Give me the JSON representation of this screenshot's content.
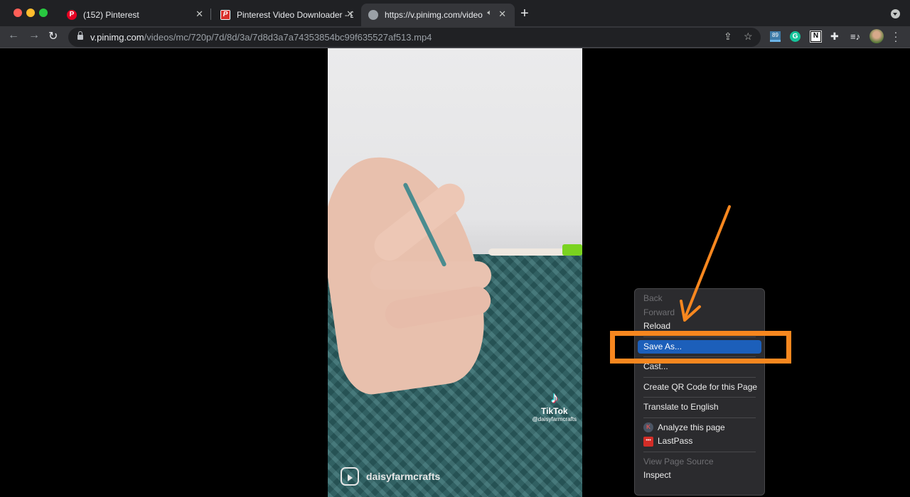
{
  "browser": {
    "tabs": [
      {
        "title": "(152) Pinterest",
        "favicon": "pinterest-icon",
        "active": false
      },
      {
        "title": "Pinterest Video Downloader - D",
        "favicon": "pinterest-video-downloader-icon",
        "active": false
      },
      {
        "title": "https://v.pinimg.com/video",
        "favicon": "globe-icon",
        "active": true,
        "audio": "speaker-icon"
      }
    ],
    "new_tab_glyph": "+",
    "close_glyph": "✕",
    "address": {
      "host": "v.pinimg.com",
      "path": "/videos/mc/720p/7d/8d/3a/7d8d3a7a74353854bc99f635527af513.mp4"
    },
    "toolbar_icons": [
      "share-icon",
      "bookmark-star-icon"
    ],
    "extensions": [
      {
        "name": "ext-89-icon",
        "label": "89"
      },
      {
        "name": "grammarly-icon",
        "label": "G"
      },
      {
        "name": "notion-icon",
        "label": "N"
      },
      {
        "name": "extensions-puzzle-icon",
        "label": ""
      },
      {
        "name": "media-control-icon",
        "label": ""
      }
    ]
  },
  "video": {
    "tiktok_brand": "TikTok",
    "tiktok_handle": "@daisyfarmcrafts",
    "reels_username": "daisyfarmcrafts"
  },
  "context_menu": {
    "groups": [
      [
        {
          "label": "Back",
          "disabled": true
        },
        {
          "label": "Forward",
          "disabled": true
        },
        {
          "label": "Reload",
          "disabled": false
        }
      ],
      [
        {
          "label": "Save As...",
          "disabled": false,
          "selected": true
        }
      ],
      [
        {
          "label": "Cast...",
          "disabled": false
        }
      ],
      [
        {
          "label": "Create QR Code for this Page",
          "disabled": false
        }
      ],
      [
        {
          "label": "Translate to English",
          "disabled": false
        }
      ],
      [
        {
          "label": "Analyze this page",
          "icon": "k-extension-icon",
          "icon_glyph": "K"
        },
        {
          "label": "LastPass",
          "icon": "lastpass-icon",
          "icon_glyph": "•••"
        }
      ],
      [
        {
          "label": "View Page Source",
          "disabled": true
        },
        {
          "label": "Inspect",
          "disabled": false
        }
      ]
    ]
  },
  "annotation": {
    "color": "#f7871f",
    "highlight_target": "Save As..."
  },
  "colors": {
    "menu_selected": "#1c5fba",
    "tabstrip": "#202124",
    "toolbar": "#35363a"
  }
}
